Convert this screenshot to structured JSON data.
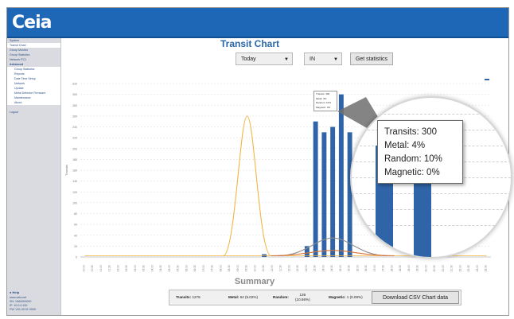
{
  "app": {
    "logo_text": "Ceia"
  },
  "sidebar": {
    "items": [
      {
        "label": "System",
        "active": false,
        "sub": false
      },
      {
        "label": "Transit Chart",
        "active": true,
        "sub": false
      },
      {
        "label": "Group Monitor",
        "active": false,
        "sub": false
      },
      {
        "label": "Group Statistics",
        "active": false,
        "sub": false
      },
      {
        "label": "Network PC1",
        "active": false,
        "sub": false
      },
      {
        "label": "Advanced",
        "active": false,
        "sub": false
      },
      {
        "label": "Group Statistics",
        "active": true,
        "sub": true
      },
      {
        "label": "Reports",
        "active": true,
        "sub": true
      },
      {
        "label": "Date Time Setup",
        "active": true,
        "sub": true
      },
      {
        "label": "Network",
        "active": true,
        "sub": true
      },
      {
        "label": "Update",
        "active": true,
        "sub": true
      },
      {
        "label": "Metal Detector Firmware",
        "active": true,
        "sub": true
      },
      {
        "label": "Maintenance",
        "active": true,
        "sub": true
      },
      {
        "label": "About",
        "active": true,
        "sub": true
      },
      {
        "label": "",
        "active": false,
        "sub": false
      },
      {
        "label": "Logout",
        "active": false,
        "sub": false
      }
    ],
    "help_label": "Help",
    "footer": [
      "www.ceia.net",
      "SN: 19A0000000",
      "IP: 10.0.0.100",
      "FW: V01.00.01 0000"
    ]
  },
  "header": {
    "title": "Transit Chart"
  },
  "controls": {
    "period_value": "Today",
    "direction_value": "IN",
    "get_stats_label": "Get statistics"
  },
  "tooltip": {
    "transits": "Transits: 300",
    "metal": "Metal: 4%",
    "random": "Random: 10%",
    "magnetic": "Magnetic: 0%"
  },
  "mini_tooltip": [
    "Transits: 300",
    "Metal: 4%",
    "Random: 10%",
    "Magnetic: 0%"
  ],
  "summary": {
    "title": "Summary",
    "transits_label": "Transits:",
    "transits_value": "1276",
    "metal_label": "Metal:",
    "metal_value": "64 (5.02%)",
    "random_label": "Random:",
    "random_value_1": "136",
    "random_value_2": "(10.66%)",
    "magnetic_label": "Magnetic:",
    "magnetic_value": "1 (0.08%)",
    "csv_label": "Download CSV Chart data"
  },
  "colors": {
    "brand": "#1d67b6",
    "bar": "#2f65a8",
    "metal_line": "#f2b542",
    "random_line": "#d9743a",
    "magnetic_line": "#8e8e8e"
  },
  "chart_data": {
    "type": "bar",
    "categories": [
      "00:00",
      "00:30",
      "01:00",
      "01:30",
      "02:00",
      "02:30",
      "03:00",
      "03:30",
      "04:00",
      "04:30",
      "05:00",
      "05:30",
      "06:00",
      "06:30",
      "07:00",
      "07:30",
      "08:00",
      "08:30",
      "09:00",
      "09:30",
      "10:00",
      "10:30",
      "11:00",
      "11:30",
      "12:00",
      "12:30",
      "13:00",
      "13:30",
      "14:00",
      "14:30",
      "15:00",
      "15:30",
      "16:00",
      "16:30",
      "17:00",
      "17:30",
      "18:00",
      "18:30",
      "19:00",
      "19:30",
      "20:00",
      "20:30",
      "21:00",
      "21:30",
      "22:00",
      "22:30",
      "23:00",
      "23:30"
    ],
    "series": [
      {
        "name": "Transits",
        "kind": "bar",
        "values": [
          0,
          0,
          0,
          0,
          0,
          0,
          0,
          0,
          0,
          0,
          0,
          0,
          0,
          0,
          0,
          0,
          0,
          0,
          0,
          0,
          0,
          5,
          0,
          0,
          0,
          0,
          20,
          250,
          230,
          240,
          300,
          230,
          0,
          0,
          0,
          0,
          0,
          0,
          0,
          0,
          0,
          0,
          0,
          0,
          0,
          0,
          0,
          0
        ]
      },
      {
        "name": "Metal",
        "kind": "line",
        "values": [
          0,
          0,
          0,
          0,
          0,
          0,
          0,
          0,
          0,
          0,
          0,
          0,
          0,
          0,
          0,
          0,
          0,
          0,
          0,
          0,
          0,
          0,
          0,
          0,
          0,
          0,
          0,
          0,
          0,
          0,
          0,
          0,
          0,
          0,
          0,
          0,
          0,
          0,
          0,
          0,
          0,
          0,
          0,
          0,
          0,
          0,
          0,
          0
        ]
      },
      {
        "name": "Random",
        "kind": "line",
        "values": [
          0,
          0,
          0,
          0,
          0,
          0,
          0,
          0,
          0,
          0,
          0,
          0,
          0,
          0,
          0,
          0,
          0,
          0,
          0,
          0,
          0,
          0,
          0,
          0,
          0,
          0,
          0,
          0,
          0,
          0,
          0,
          0,
          0,
          0,
          0,
          0,
          0,
          0,
          0,
          0,
          0,
          0,
          0,
          0,
          0,
          0,
          0,
          0
        ]
      },
      {
        "name": "Magnetic",
        "kind": "line",
        "values": [
          0,
          0,
          0,
          0,
          0,
          0,
          0,
          0,
          0,
          0,
          0,
          0,
          0,
          0,
          0,
          0,
          0,
          0,
          0,
          0,
          0,
          0,
          0,
          0,
          0,
          0,
          0,
          0,
          0,
          0,
          0,
          0,
          0,
          0,
          0,
          0,
          0,
          0,
          0,
          0,
          0,
          0,
          0,
          0,
          0,
          0,
          0,
          0
        ]
      }
    ],
    "overlay_curves": {
      "yellow_peak": {
        "category_index": 19,
        "value": 260
      },
      "grey_peak": {
        "category_index": 29,
        "value": 35
      },
      "orange_peak": {
        "category_index": 29,
        "value": 12
      }
    },
    "ylim": [
      0,
      320
    ],
    "grid": true,
    "title": "",
    "xlabel": "",
    "ylabel": "Transits"
  }
}
